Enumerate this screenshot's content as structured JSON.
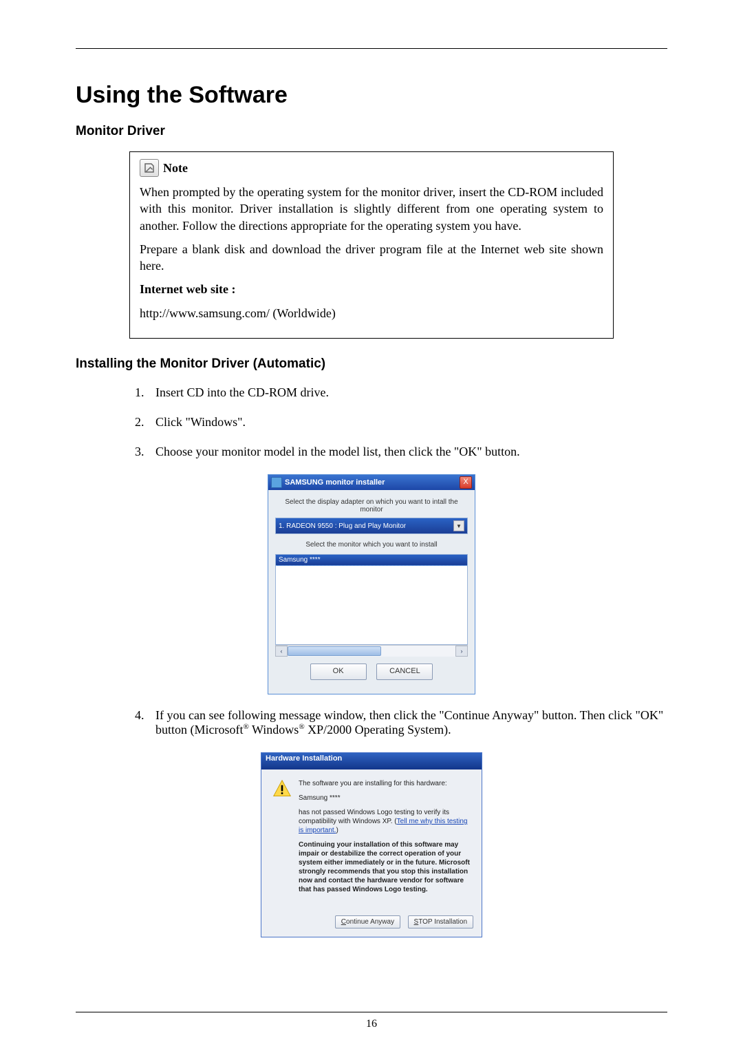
{
  "page": {
    "title": "Using the Software",
    "section1": "Monitor Driver",
    "section2": "Installing the Monitor Driver (Automatic)",
    "number": "16"
  },
  "note": {
    "label": "Note",
    "p1": "When prompted by the operating system for the monitor driver, insert the CD-ROM included with this monitor. Driver installation is slightly different from one operating system to another. Follow the directions appropriate for the operating system you have.",
    "p2": "Prepare a blank disk and download the driver program file at the Internet web site shown here.",
    "label2": "Internet web site :",
    "url": "http://www.samsung.com/ (Worldwide)"
  },
  "steps": {
    "s1": "Insert CD into the CD-ROM drive.",
    "s2": "Click \"Windows\".",
    "s3": "Choose your monitor model in the model list, then click the \"OK\" button.",
    "s4a": "If you can see following message window, then click the \"Continue Anyway\" button. Then click \"OK\" button (Microsoft",
    "s4b": " Windows",
    "s4c": " XP/2000 Operating System)."
  },
  "dlg1": {
    "title": "SAMSUNG monitor installer",
    "close": "X",
    "label1": "Select the display adapter on which you want to intall the monitor",
    "combo": "1. RADEON 9550 : Plug and Play Monitor",
    "combo_arrow": "▼",
    "label2": "Select the monitor which you want to install",
    "selected": "Samsung ****",
    "scroll_left": "‹",
    "scroll_right": "›",
    "ok": "OK",
    "cancel": "CANCEL"
  },
  "dlg2": {
    "title": "Hardware Installation",
    "line1": "The software you are installing for this hardware:",
    "product": "Samsung ****",
    "line2a": "has not passed Windows Logo testing to verify its compatibility with Windows XP. (",
    "link": "Tell me why this testing is important.",
    "line2b": ")",
    "bold": "Continuing your installation of this software may impair or destabilize the correct operation of your system either immediately or in the future. Microsoft strongly recommends that you stop this installation now and contact the hardware vendor for software that has passed Windows Logo testing.",
    "continue_u": "C",
    "continue_rest": "ontinue Anyway",
    "stop_u": "S",
    "stop_rest": "TOP Installation"
  },
  "reg": "®"
}
